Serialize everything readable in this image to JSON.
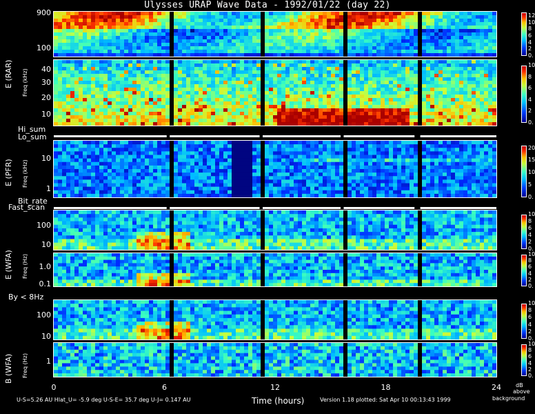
{
  "title": "Ulysses URAP Wave Data - 1992/01/22  (day 22)",
  "x_axis": {
    "label": "Time (hours)",
    "ticks": [
      "0",
      "6",
      "12",
      "18",
      "24"
    ],
    "range": [
      0,
      24
    ]
  },
  "footer": {
    "ephemeris": "U-S=5.26 AU  Hlat_U= -5.9 deg  U-S-E= 35.7 deg  U-J= 0.147 AU",
    "version": "Version 1.18 plotted: Sat Apr 10 00:13:43 1999",
    "units_line1": "dB",
    "units_line2": "above",
    "units_line3": "background"
  },
  "indicator_labels": {
    "hi_sum": "Hi_sum",
    "lo_sum": "Lo_sum",
    "bit_rate": "Bit_rate",
    "fast_scan": "Fast_scan",
    "by_8hz": "By < 8Hz"
  },
  "group_labels": {
    "rar": "E (RAR)",
    "pfr": "E (PFR)",
    "wfa_e": "E (WFA)",
    "wfa_b": "B (WFA)",
    "freq_khz": "Freq (kHz)",
    "freq_hz": "Freq (Hz)"
  },
  "chart_data": [
    {
      "type": "heatmap",
      "name": "E (RAR) high",
      "ylabel": "Freq (kHz)",
      "y_ticks": [
        "900",
        "100"
      ],
      "colorbar_ticks": [
        "0.",
        "2",
        "4",
        "6",
        "8",
        "10",
        "12"
      ],
      "colorbar_range": [
        0,
        13
      ]
    },
    {
      "type": "heatmap",
      "name": "E (RAR) low",
      "ylabel": "Freq (kHz)",
      "y_ticks": [
        "40",
        "30",
        "20",
        "10"
      ],
      "colorbar_ticks": [
        "0.",
        "2",
        "4",
        "6",
        "8",
        "10"
      ],
      "colorbar_range": [
        0,
        10
      ]
    },
    {
      "type": "heatmap",
      "name": "E (PFR)",
      "ylabel": "Freq (kHz)",
      "y_ticks": [
        "10",
        "1"
      ],
      "colorbar_ticks": [
        "0.",
        "5",
        "10",
        "15",
        "20"
      ],
      "colorbar_range": [
        0,
        21
      ]
    },
    {
      "type": "heatmap",
      "name": "E (WFA) high",
      "ylabel": "Freq (Hz)",
      "y_ticks": [
        "100",
        "10"
      ],
      "colorbar_ticks": [
        "0.",
        "2",
        "4",
        "6",
        "8",
        "10"
      ],
      "colorbar_range": [
        0,
        10
      ]
    },
    {
      "type": "heatmap",
      "name": "E (WFA) low",
      "ylabel": "Freq (Hz)",
      "y_ticks": [
        "1.0",
        "0.1"
      ],
      "colorbar_ticks": [
        "0.",
        "2",
        "4",
        "6",
        "8",
        "10"
      ],
      "colorbar_range": [
        0,
        10
      ]
    },
    {
      "type": "heatmap",
      "name": "B (WFA) high",
      "ylabel": "Freq (Hz)",
      "y_ticks": [
        "100",
        "10"
      ],
      "colorbar_ticks": [
        "0.",
        "2",
        "4",
        "6",
        "8",
        "10"
      ],
      "colorbar_range": [
        0,
        10
      ]
    },
    {
      "type": "heatmap",
      "name": "B (WFA) low",
      "ylabel": "Freq (Hz)",
      "y_ticks": [
        "1"
      ],
      "colorbar_ticks": [
        "0.",
        "2",
        "4",
        "6",
        "8",
        "10"
      ],
      "colorbar_range": [
        0,
        10
      ]
    }
  ]
}
